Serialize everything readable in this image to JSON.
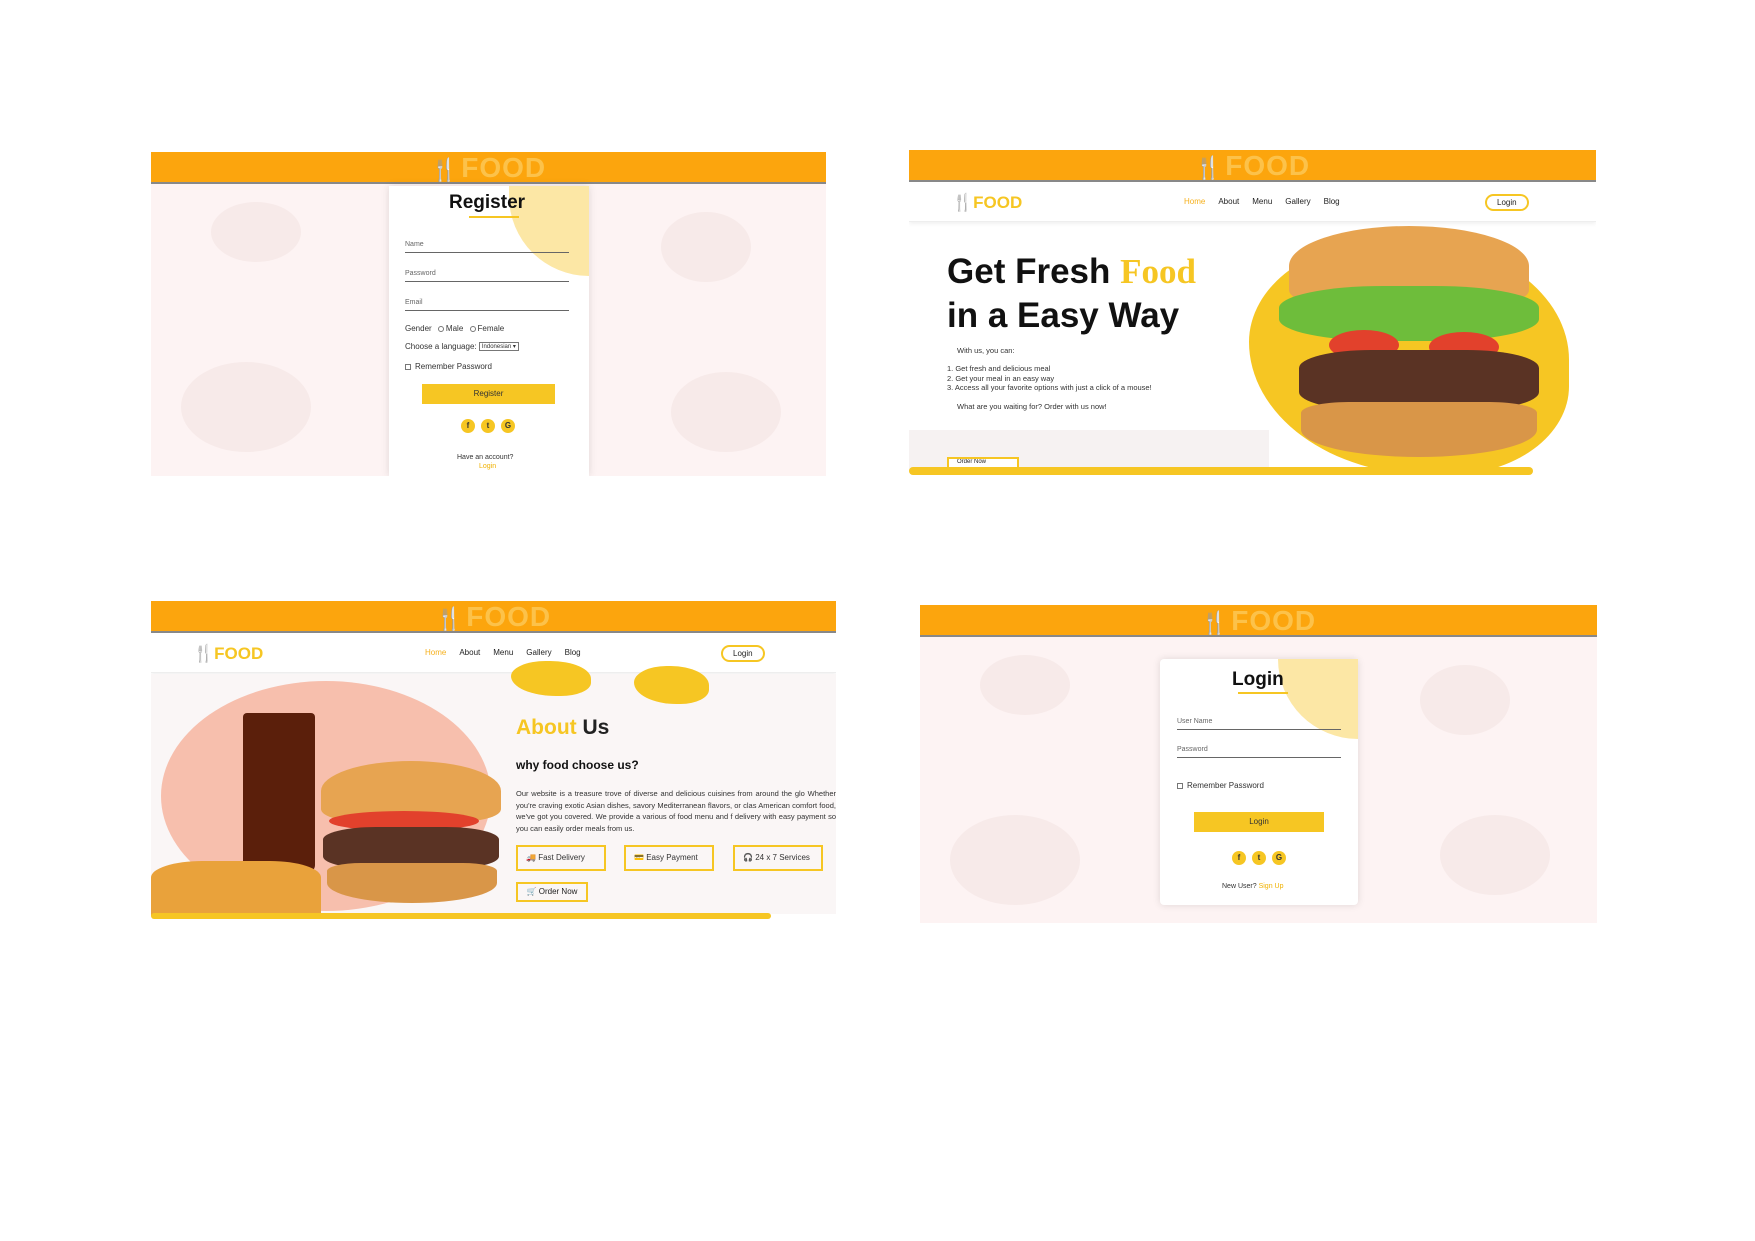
{
  "brand": {
    "logo_text": "FOOD",
    "fork_glyph": "🍴"
  },
  "register": {
    "title": "Register",
    "fields": {
      "name": "Name",
      "password": "Password",
      "email": "Email"
    },
    "gender_label": "Gender",
    "gender_options": [
      "Male",
      "Female"
    ],
    "language_label": "Choose a language:",
    "language_value": "Indonesian",
    "remember_label": "Remember Password",
    "submit_label": "Register",
    "social": [
      "f",
      "t",
      "G"
    ],
    "have_account": "Have an account?",
    "login_link": "Login"
  },
  "home": {
    "nav": {
      "items": [
        "Home",
        "About",
        "Menu",
        "Gallery",
        "Blog"
      ],
      "login": "Login"
    },
    "hero_line1": "Get Fresh",
    "hero_accent": "Food",
    "hero_line2": "in a Easy Way",
    "intro": "With us, you can:",
    "list": [
      "1. Get fresh and delicious meal",
      "2. Get your meal in an easy way",
      "3. Access all your favorite options with just a click of a mouse!"
    ],
    "cta_text": "What are you waiting for? Order with us now!",
    "order_btn": "Order Now"
  },
  "about": {
    "nav": {
      "items": [
        "Home",
        "About",
        "Menu",
        "Gallery",
        "Blog"
      ],
      "login": "Login"
    },
    "title_accent": "About",
    "title_rest": "Us",
    "subtitle": "why food choose us?",
    "paragraph": "Our website is a treasure trove of diverse and delicious cuisines from around the glo Whether you're craving exotic Asian dishes, savory Mediterranean flavors, or clas American comfort food, we've got you covered. We provide a various of food menu and f delivery with easy payment so you can easily order meals from us.",
    "features": [
      "Fast Delivery",
      "Easy Payment",
      "24 x 7 Services"
    ],
    "order_btn": "Order Now"
  },
  "login": {
    "title": "Login",
    "fields": {
      "username": "User Name",
      "password": "Password"
    },
    "remember_label": "Remember Password",
    "submit_label": "Login",
    "social": [
      "f",
      "t",
      "G"
    ],
    "new_user": "New User?",
    "signup_link": "Sign Up"
  },
  "colors": {
    "orange_banner": "#fca50d",
    "accent_yellow": "#f6c623",
    "bg_pink": "#fdf3f3"
  }
}
